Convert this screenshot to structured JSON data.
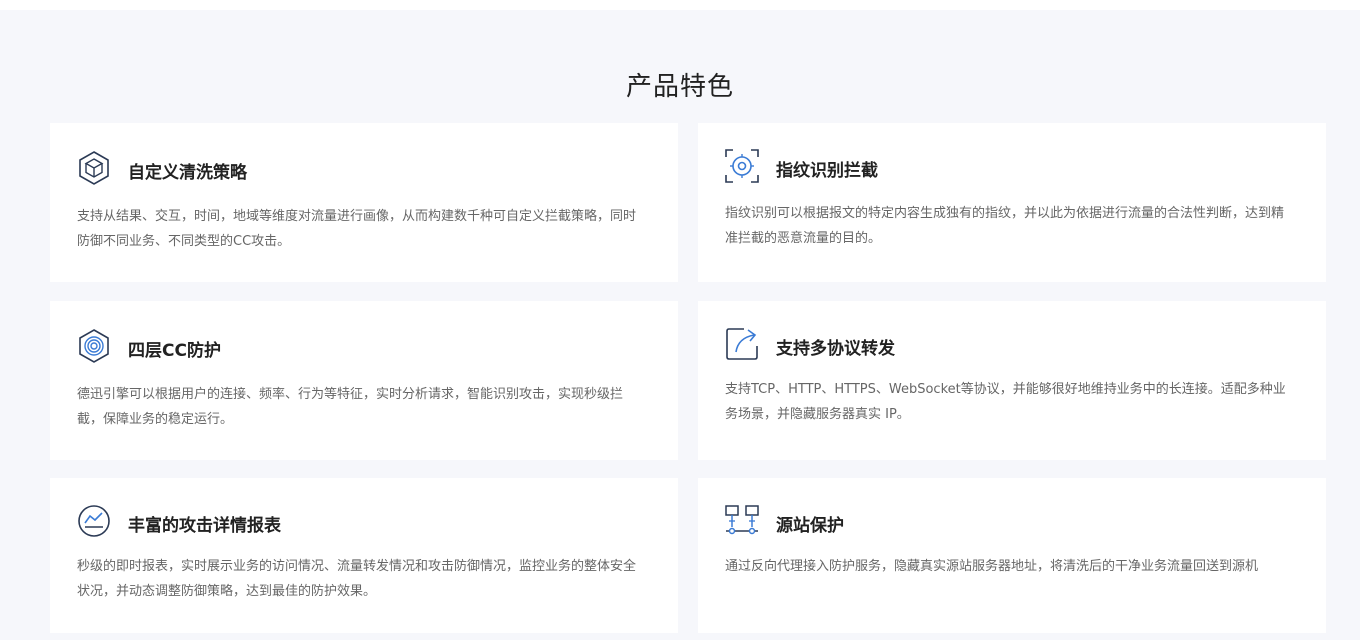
{
  "section": {
    "title": "产品特色"
  },
  "cards": [
    {
      "icon": "cube-hexagon-icon",
      "title": "自定义清洗策略",
      "desc": "支持从结果、交互，时间，地域等维度对流量进行画像，从而构建数千种可自定义拦截策略，同时防御不同业务、不同类型的CC攻击。"
    },
    {
      "icon": "fingerprint-target-icon",
      "title": "指纹识别拦截",
      "desc": "指纹识别可以根据报文的特定内容生成独有的指纹，并以此为依据进行流量的合法性判断，达到精准拦截的恶意流量的目的。"
    },
    {
      "icon": "layered-shield-hexagon-icon",
      "title": "四层CC防护",
      "desc": "德迅引擎可以根据用户的连接、频率、行为等特征，实时分析请求，智能识别攻击，实现秒级拦截，保障业务的稳定运行。"
    },
    {
      "icon": "forward-arrow-icon",
      "title": "支持多协议转发",
      "desc": "支持TCP、HTTP、HTTPS、WebSocket等协议，并能够很好地维持业务中的长连接。适配多种业务场景，并隐藏服务器真实 IP。"
    },
    {
      "icon": "chart-report-icon",
      "title": "丰富的攻击详情报表",
      "desc": "秒级的即时报表，实时展示业务的访问情况、流量转发情况和攻击防御情况，监控业务的整体安全状况，并动态调整防御策略，达到最佳的防护效果。"
    },
    {
      "icon": "network-servers-icon",
      "title": "源站保护",
      "desc": "通过反向代理接入防护服务，隐藏真实源站服务器地址，将清洗后的干净业务流量回送到源机"
    }
  ]
}
